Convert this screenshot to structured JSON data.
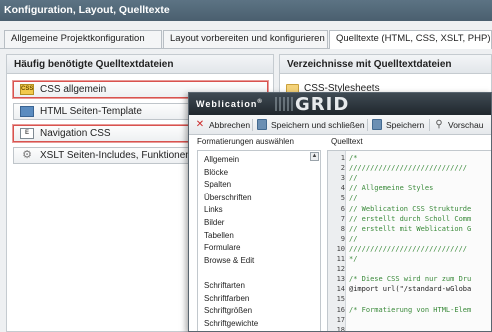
{
  "window": {
    "title": "Konfiguration, Layout, Quelltexte"
  },
  "tabs": [
    {
      "label": "Allgemeine Projektkonfiguration"
    },
    {
      "label": "Layout vorbereiten und konfigurieren"
    },
    {
      "label": "Quelltexte (HTML, CSS, XSLT, PHP) a"
    }
  ],
  "left_panel": {
    "title": "Häufig benötigte Quelltextdateien",
    "items": [
      {
        "label": "CSS allgemein",
        "icon": "css-file-icon",
        "icon_text": "CSS"
      },
      {
        "label": "HTML Seiten-Template",
        "icon": "html-file-icon",
        "icon_text": ""
      },
      {
        "label": "Navigation CSS",
        "icon": "document-icon",
        "icon_text": "E"
      },
      {
        "label": "XSLT Seiten-Includes, Funktionen",
        "icon": "xslt-file-icon",
        "icon_text": "⚙"
      }
    ]
  },
  "right_panel": {
    "title": "Verzeichnisse mit Quelltextdateien",
    "folder_label": "CSS-Stylesheets"
  },
  "dialog": {
    "brand": "Weblication",
    "brand_reg": "®",
    "product": "GRID",
    "toolbar": {
      "cancel": "Abbrechen",
      "save_close": "Speichern und schließen",
      "save": "Speichern",
      "preview": "Vorschau"
    },
    "formats_label": "Formatierungen auswählen",
    "source_label": "Quelltext",
    "formats": [
      "Allgemein",
      "Blöcke",
      "Spalten",
      "Überschriften",
      "Links",
      "Bilder",
      "Tabellen",
      "Formulare",
      "Browse & Edit",
      "",
      "Schriftarten",
      "Schriftfarben",
      "Schriftgrößen",
      "Schriftgewichte"
    ],
    "code_lines": [
      {
        "n": "1",
        "text": "/*"
      },
      {
        "n": "2",
        "text": "////////////////////////////"
      },
      {
        "n": "3",
        "text": "//"
      },
      {
        "n": "4",
        "text": "// Allgemeine Styles"
      },
      {
        "n": "5",
        "text": "//"
      },
      {
        "n": "6",
        "text": "// Weblication CSS Strukturde"
      },
      {
        "n": "7",
        "text": "// erstellt durch Scholl Comm"
      },
      {
        "n": "8",
        "text": "// erstellt mit Weblication G"
      },
      {
        "n": "9",
        "text": "//"
      },
      {
        "n": "10",
        "text": "////////////////////////////"
      },
      {
        "n": "11",
        "text": "*/"
      },
      {
        "n": "12",
        "text": ""
      },
      {
        "n": "13",
        "text": "/* Diese CSS wird nur zum Dru"
      },
      {
        "n": "14",
        "text": "@import url(\"/standard-wGloba"
      },
      {
        "n": "15",
        "text": ""
      },
      {
        "n": "16",
        "text": "/* Formatierung von HTML-Elem"
      },
      {
        "n": "17",
        "text": ""
      },
      {
        "n": "18",
        "text": ""
      }
    ]
  },
  "colors": {
    "titlebar": "#4a5f6f",
    "highlight_border": "#d9534f",
    "comment": "#3a8a3a"
  }
}
